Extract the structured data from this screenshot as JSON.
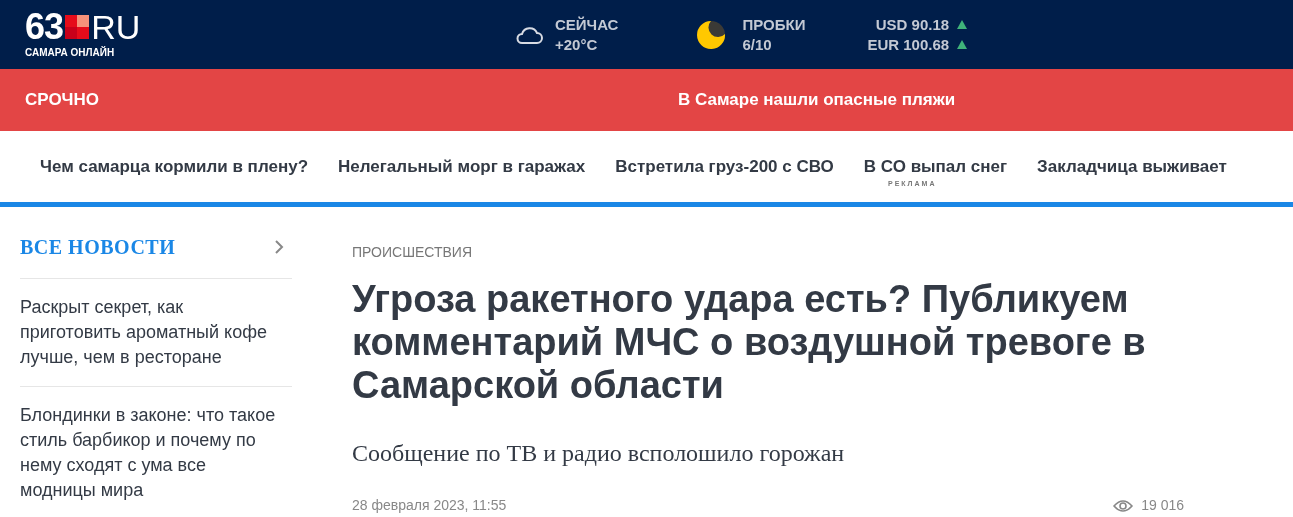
{
  "logo": {
    "number": "63",
    "domain": "RU",
    "subtitle": "САМАРА ОНЛАЙН"
  },
  "weather": {
    "label": "СЕЙЧАС",
    "value": "+20°C"
  },
  "traffic": {
    "label": "ПРОБКИ",
    "value": "6/10"
  },
  "currencies": [
    {
      "text": "USD 90.18",
      "rising": true
    },
    {
      "text": "EUR 100.68",
      "rising": true
    }
  ],
  "breaking": {
    "label": "СРОЧНО",
    "headline": "В Самаре нашли опасные пляжи"
  },
  "nav": [
    "Чем самарца кормили в плену?",
    "Нелегальный морг в гаражах",
    "Встретила груз-200 с СВО",
    "В СО выпал снег",
    "Закладчица выживает"
  ],
  "ad_label": "РЕКЛАМА",
  "sidebar": {
    "title": "ВСЕ НОВОСТИ",
    "items": [
      "Раскрыт секрет, как приготовить ароматный кофе лучше, чем в ресторане",
      "Блондинки в законе: что такое стиль барбикор и почему по нему сходят с ума все модницы мира"
    ]
  },
  "article": {
    "category": "ПРОИСШЕСТВИЯ",
    "title": "Угроза ракетного удара есть? Публикуем комментарий МЧС о воздушной тревоге в Самарской области",
    "subtitle": "Сообщение по ТВ и радио всполошило горожан",
    "date": "28 февраля 2023, 11:55",
    "views": "19 016"
  }
}
